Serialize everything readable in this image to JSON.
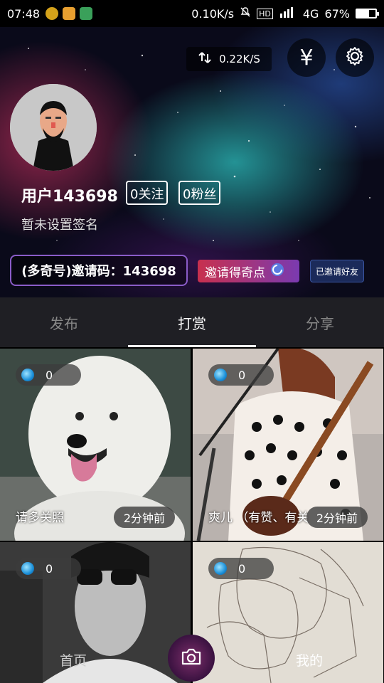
{
  "status_bar": {
    "time": "07:48",
    "net_speed": "0.10K/s",
    "hd": "HD",
    "network": "4G",
    "battery": "67%",
    "battery_level": 0.67
  },
  "header": {
    "speed": "0.22K/S",
    "yuan_symbol": "¥",
    "username": "用户143698",
    "following": "0关注",
    "followers": "0粉丝",
    "signature": "暂未设置签名",
    "invite_code": "(多奇号)邀请码：143698",
    "invite_get": "邀请得奇点",
    "invited_friends": "已邀请好友"
  },
  "tabs": [
    {
      "label": "发布",
      "active": false
    },
    {
      "label": "打赏",
      "active": true
    },
    {
      "label": "分享",
      "active": false
    }
  ],
  "posts": [
    {
      "likes": "0",
      "caption": "请多关照",
      "time": "2分钟前"
    },
    {
      "likes": "0",
      "caption": "爽儿 （有赞、有关",
      "time": "2分钟前"
    },
    {
      "likes": "0",
      "caption": "",
      "time": ""
    },
    {
      "likes": "0",
      "caption": "",
      "time": ""
    }
  ],
  "bottom_nav": {
    "home": "首页",
    "mine": "我的"
  },
  "colors": {
    "accent_purple": "#8a5cc8",
    "invite_red": "#c8304e",
    "tab_bg": "#1f1f24"
  }
}
